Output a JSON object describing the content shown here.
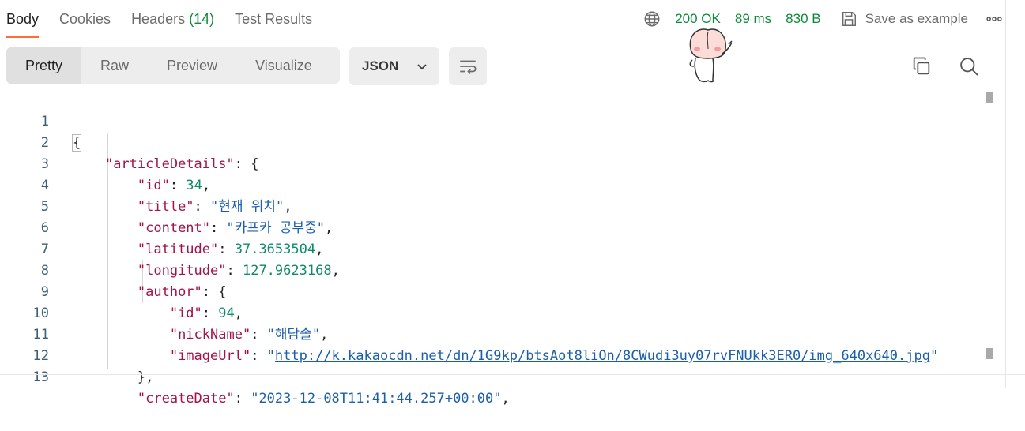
{
  "tabs": [
    {
      "label": "Body",
      "active": true
    },
    {
      "label": "Cookies"
    },
    {
      "label": "Headers ",
      "count": "(14)"
    },
    {
      "label": "Test Results"
    }
  ],
  "status": {
    "code": "200 OK",
    "time": "89 ms",
    "size": "830 B",
    "save_label": "Save as example"
  },
  "modes": [
    "Pretty",
    "Raw",
    "Preview",
    "Visualize"
  ],
  "format": "JSON",
  "colors": {
    "accent": "#ff6c37",
    "status_green": "#0f8a3c",
    "key": "#a1134a",
    "string": "#1b5faa",
    "number": "#0f8a6a"
  },
  "icons": [
    "globe-icon",
    "save-icon",
    "more-icon",
    "chevron-down-icon",
    "wrap-lines-icon",
    "copy-icon",
    "search-icon"
  ],
  "editor": {
    "lines": [
      "1",
      "2",
      "3",
      "4",
      "5",
      "6",
      "7",
      "8",
      "9",
      "10",
      "11",
      "12",
      "13"
    ],
    "keys": {
      "articleDetails": "\"articleDetails\"",
      "id": "\"id\"",
      "title": "\"title\"",
      "content": "\"content\"",
      "latitude": "\"latitude\"",
      "longitude": "\"longitude\"",
      "author": "\"author\"",
      "author_id": "\"id\"",
      "nickName": "\"nickName\"",
      "imageUrl": "\"imageUrl\"",
      "createDate": "\"createDate\""
    },
    "values": {
      "id": "34",
      "title": "\"현재 위치\"",
      "content": "\"카프카 공부중\"",
      "latitude": "37.3653504",
      "longitude": "127.9623168",
      "author_id": "94",
      "nickName": "\"해담솔\"",
      "imageUrl": "http://k.kakaocdn.net/dn/1G9kp/btsAot8liOn/8CWudi3uy07rvFNUkk3ER0/img_640x640.jpg",
      "createDate": "\"2023-12-08T11:41:44.257+00:00\""
    }
  }
}
